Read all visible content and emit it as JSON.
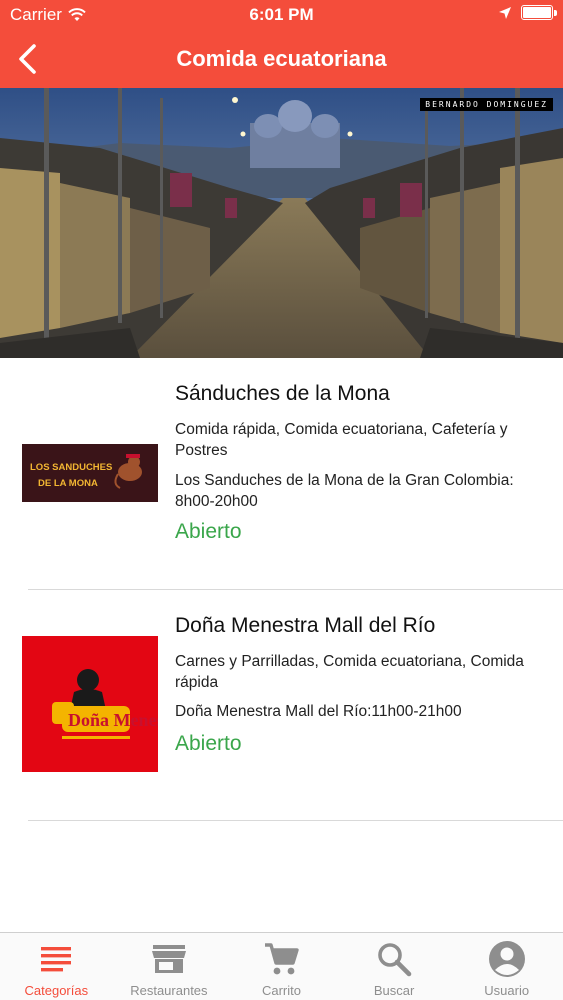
{
  "status_bar": {
    "carrier": "Carrier",
    "time": "6:01 PM"
  },
  "nav": {
    "title": "Comida ecuatoriana"
  },
  "hero": {
    "credit": "BERNARDO DOMINGUEZ"
  },
  "restaurants": [
    {
      "logo_text": "LOS SANDUCHES DE LA MONA",
      "name": "Sánduches de la Mona",
      "categories": "Comida rápida, Comida ecuatoriana, Cafetería y Postres",
      "hours": " Los Sanduches de la Mona de la Gran Colombia: 8h00-20h00",
      "status": "Abierto"
    },
    {
      "logo_text": "Doña Menestra",
      "name": "Doña Menestra Mall del Río",
      "categories": "Carnes y Parrilladas, Comida ecuatoriana, Comida rápida",
      "hours": " Doña Menestra Mall del Río:11h00-21h00",
      "status": "Abierto"
    }
  ],
  "tabs": [
    {
      "label": "Categorías",
      "icon": "list-icon",
      "active": true
    },
    {
      "label": "Restaurantes",
      "icon": "store-icon",
      "active": false
    },
    {
      "label": "Carrito",
      "icon": "cart-icon",
      "active": false
    },
    {
      "label": "Buscar",
      "icon": "search-icon",
      "active": false
    },
    {
      "label": "Usuario",
      "icon": "user-icon",
      "active": false
    }
  ],
  "colors": {
    "accent": "#f44d3b",
    "open_status": "#3aa64b",
    "tab_inactive": "#8e8e8e"
  }
}
